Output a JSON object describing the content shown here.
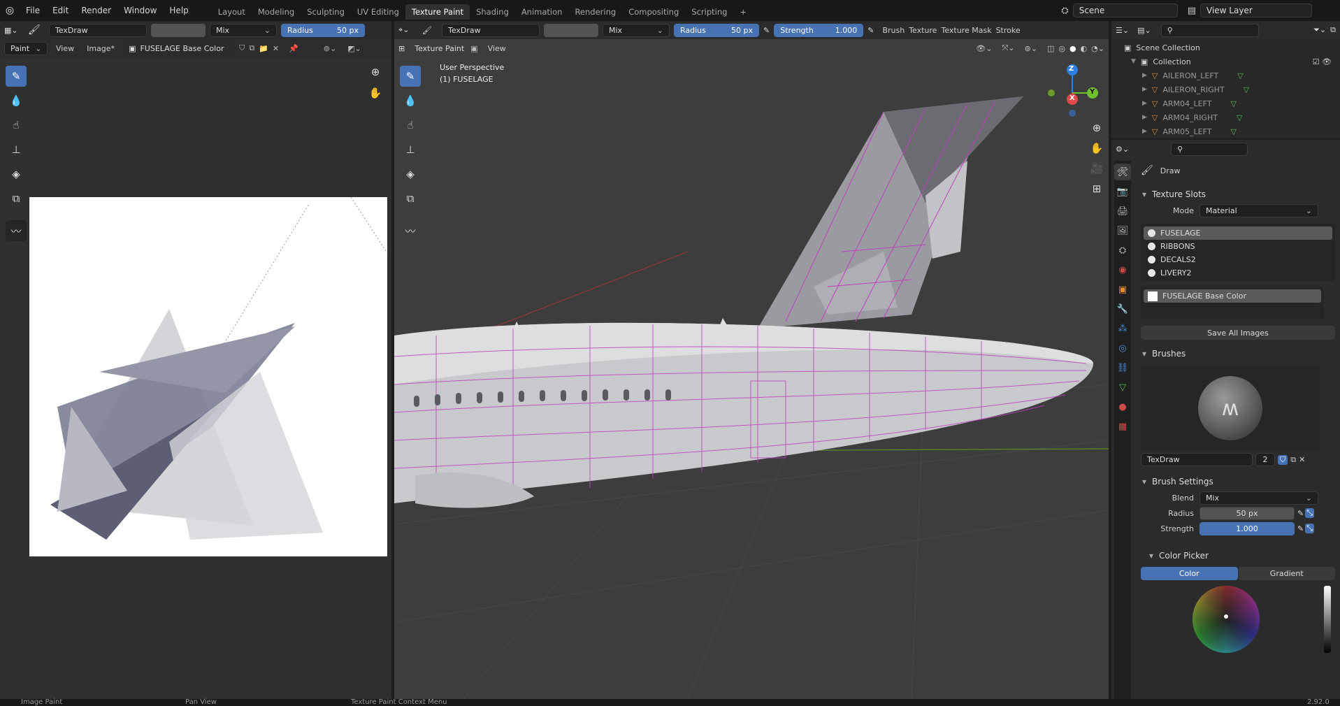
{
  "topbar": {
    "menus": [
      "File",
      "Edit",
      "Render",
      "Window",
      "Help"
    ],
    "workspaces": [
      "Layout",
      "Modeling",
      "Sculpting",
      "UV Editing",
      "Texture Paint",
      "Shading",
      "Animation",
      "Rendering",
      "Compositing",
      "Scripting"
    ],
    "active_workspace": "Texture Paint",
    "add_tab": "+",
    "scene": "Scene",
    "view_layer": "View Layer"
  },
  "image_editor": {
    "brush_name": "TexDraw",
    "blend": "Mix",
    "radius_label": "Radius",
    "radius_value": "50 px",
    "mode": "Paint",
    "view_menu": "View",
    "image_menu": "Image*",
    "image_name": "FUSELAGE Base Color"
  },
  "viewport": {
    "brush_name": "TexDraw",
    "blend": "Mix",
    "radius_label": "Radius",
    "radius_value": "50 px",
    "strength_label": "Strength",
    "strength_value": "1.000",
    "menus": [
      "Brush",
      "Texture",
      "Texture Mask",
      "Stroke"
    ],
    "mode": "Texture Paint",
    "view_menu": "View",
    "overlay_line1": "User Perspective",
    "overlay_line2": "(1) FUSELAGE",
    "gizmo": {
      "x": "X",
      "y": "Y",
      "z": "Z"
    }
  },
  "outliner": {
    "root": "Scene Collection",
    "collection": "Collection",
    "items": [
      "AILERON_LEFT",
      "AILERON_RIGHT",
      "ARM04_LEFT",
      "ARM04_RIGHT",
      "ARM05_LEFT"
    ]
  },
  "properties": {
    "tool_name": "Draw",
    "texture_slots": {
      "title": "Texture Slots",
      "mode_label": "Mode",
      "mode_value": "Material",
      "slots": [
        "FUSELAGE",
        "RIBBONS",
        "DECALS2",
        "LIVERY2"
      ],
      "selected": "FUSELAGE",
      "image": "FUSELAGE Base Color",
      "save_all": "Save All Images"
    },
    "brushes": {
      "title": "Brushes",
      "brush_name": "TexDraw",
      "users": "2"
    },
    "brush_settings": {
      "title": "Brush Settings",
      "blend_label": "Blend",
      "blend_value": "Mix",
      "radius_label": "Radius",
      "radius_value": "50 px",
      "strength_label": "Strength",
      "strength_value": "1.000"
    },
    "color_picker": {
      "title": "Color Picker",
      "tabs": [
        "Color",
        "Gradient"
      ],
      "active_tab": "Color"
    }
  },
  "statusbar": {
    "left": "Image Paint",
    "middle": "Pan View",
    "right": "Texture Paint Context Menu",
    "version": "2.92.0"
  },
  "colors": {
    "accent": "#4772b3",
    "wire": "#c040c0",
    "panel": "#2b2b2b",
    "viewport_bg": "#3d3d3d"
  }
}
